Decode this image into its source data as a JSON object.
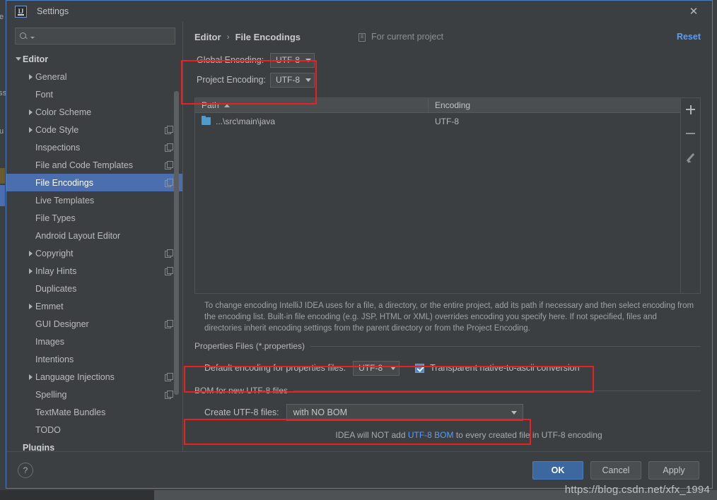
{
  "window": {
    "title": "Settings",
    "app_icon": "intellij-idea-icon",
    "close_icon": "close-icon"
  },
  "sidebar": {
    "search": {
      "placeholder": "",
      "icon": "search-icon"
    },
    "items": [
      {
        "label": "Editor",
        "indent": 0,
        "twisty": "down",
        "badge": false,
        "selected": false,
        "bold": true
      },
      {
        "label": "General",
        "indent": 1,
        "twisty": "right",
        "badge": false,
        "selected": false,
        "bold": false
      },
      {
        "label": "Font",
        "indent": 1,
        "twisty": "none",
        "badge": false,
        "selected": false,
        "bold": false
      },
      {
        "label": "Color Scheme",
        "indent": 1,
        "twisty": "right",
        "badge": false,
        "selected": false,
        "bold": false
      },
      {
        "label": "Code Style",
        "indent": 1,
        "twisty": "right",
        "badge": true,
        "selected": false,
        "bold": false
      },
      {
        "label": "Inspections",
        "indent": 1,
        "twisty": "none",
        "badge": true,
        "selected": false,
        "bold": false
      },
      {
        "label": "File and Code Templates",
        "indent": 1,
        "twisty": "none",
        "badge": true,
        "selected": false,
        "bold": false
      },
      {
        "label": "File Encodings",
        "indent": 1,
        "twisty": "none",
        "badge": true,
        "selected": true,
        "bold": false
      },
      {
        "label": "Live Templates",
        "indent": 1,
        "twisty": "none",
        "badge": false,
        "selected": false,
        "bold": false
      },
      {
        "label": "File Types",
        "indent": 1,
        "twisty": "none",
        "badge": false,
        "selected": false,
        "bold": false
      },
      {
        "label": "Android Layout Editor",
        "indent": 1,
        "twisty": "none",
        "badge": false,
        "selected": false,
        "bold": false
      },
      {
        "label": "Copyright",
        "indent": 1,
        "twisty": "right",
        "badge": true,
        "selected": false,
        "bold": false
      },
      {
        "label": "Inlay Hints",
        "indent": 1,
        "twisty": "right",
        "badge": true,
        "selected": false,
        "bold": false
      },
      {
        "label": "Duplicates",
        "indent": 1,
        "twisty": "none",
        "badge": false,
        "selected": false,
        "bold": false
      },
      {
        "label": "Emmet",
        "indent": 1,
        "twisty": "right",
        "badge": false,
        "selected": false,
        "bold": false
      },
      {
        "label": "GUI Designer",
        "indent": 1,
        "twisty": "none",
        "badge": true,
        "selected": false,
        "bold": false
      },
      {
        "label": "Images",
        "indent": 1,
        "twisty": "none",
        "badge": false,
        "selected": false,
        "bold": false
      },
      {
        "label": "Intentions",
        "indent": 1,
        "twisty": "none",
        "badge": false,
        "selected": false,
        "bold": false
      },
      {
        "label": "Language Injections",
        "indent": 1,
        "twisty": "right",
        "badge": true,
        "selected": false,
        "bold": false
      },
      {
        "label": "Spelling",
        "indent": 1,
        "twisty": "none",
        "badge": true,
        "selected": false,
        "bold": false
      },
      {
        "label": "TextMate Bundles",
        "indent": 1,
        "twisty": "none",
        "badge": false,
        "selected": false,
        "bold": false
      },
      {
        "label": "TODO",
        "indent": 1,
        "twisty": "none",
        "badge": false,
        "selected": false,
        "bold": false
      },
      {
        "label": "Plugins",
        "indent": 0,
        "twisty": "none",
        "badge": false,
        "selected": false,
        "bold": true
      }
    ]
  },
  "main": {
    "breadcrumb": {
      "parent": "Editor",
      "separator": "›",
      "current": "File Encodings"
    },
    "for_current_project": {
      "label": "For current project",
      "icon": "project-scope-icon"
    },
    "reset_label": "Reset",
    "global_encoding": {
      "label": "Global Encoding:",
      "value": "UTF-8"
    },
    "project_encoding": {
      "label": "Project Encoding:",
      "value": "UTF-8"
    },
    "table": {
      "columns": [
        "Path",
        "Encoding"
      ],
      "sort_column": "Path",
      "sort_direction": "asc",
      "rows": [
        {
          "path": "...\\src\\main\\java",
          "encoding": "UTF-8"
        }
      ],
      "toolbar": [
        "add-icon",
        "remove-icon",
        "edit-icon"
      ]
    },
    "help_text": "To change encoding IntelliJ IDEA uses for a file, a directory, or the entire project, add its path if necessary and then select encoding from the encoding list. Built-in file encoding (e.g. JSP, HTML or XML) overrides encoding you specify here. If not specified, files and directories inherit encoding settings from the parent directory or from the Project Encoding.",
    "properties_section": {
      "title": "Properties Files (*.properties)",
      "default_encoding_label": "Default encoding for properties files:",
      "default_encoding_value": "UTF-8",
      "transparent_label": "Transparent native-to-ascii conversion",
      "transparent_checked": true
    },
    "bom_section": {
      "title": "BOM for new UTF-8 files",
      "create_label": "Create UTF-8 files:",
      "create_value": "with NO BOM",
      "note_prefix": "IDEA will NOT add ",
      "note_link": "UTF-8 BOM",
      "note_suffix": " to every created file in UTF-8 encoding"
    }
  },
  "footer": {
    "help_icon": "help-icon",
    "ok_label": "OK",
    "cancel_label": "Cancel",
    "apply_label": "Apply"
  },
  "watermark": "https://blog.csdn.net/xfx_1994",
  "backdrop": {
    "fragment_top": "e",
    "fragment_mid_1": "ss",
    "fragment_mid_2": "u"
  },
  "colors": {
    "accent_blue": "#4b6eaf",
    "link_blue": "#589df6",
    "highlight_red": "#f01f1f",
    "panel_bg": "#3c3f41",
    "folder_blue": "#4f9ccc"
  }
}
